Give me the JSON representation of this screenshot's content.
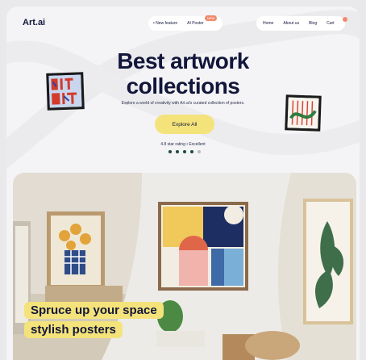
{
  "brand": {
    "logo": "Art.ai"
  },
  "nav": {
    "pill_items": [
      "• New feature",
      "AI Poster"
    ],
    "badge": "NEW",
    "links": [
      "Home",
      "About us",
      "Blog",
      "Cart"
    ]
  },
  "hero": {
    "title_line1": "Best artwork",
    "title_line2": "collections",
    "subtitle": "Explore a world of creativity with Art.ai's curated collection of posters.",
    "cta": "Explore All",
    "rating": "4.8 star rating • Excellent",
    "stars": 4,
    "stars_max": 5
  },
  "caption": {
    "line1": "Spruce up your space",
    "line2": "stylish posters"
  },
  "colors": {
    "accent_yellow": "#f4e37a",
    "navy": "#12163a",
    "badge": "#f08a6b",
    "green_dot": "#1c4a3c"
  },
  "icons": [
    "cart-icon",
    "star-dot-icon"
  ]
}
